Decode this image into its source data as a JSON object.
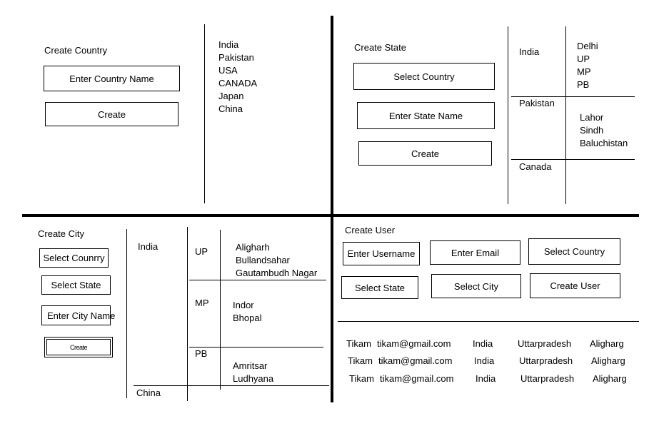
{
  "country_panel": {
    "title": "Create Country",
    "input_placeholder": "Enter Country Name",
    "create_button": "Create",
    "countries": [
      "India",
      "Pakistan",
      "USA",
      "CANADA",
      "Japan",
      "China"
    ]
  },
  "state_panel": {
    "title": "Create State",
    "select_country": "Select Country",
    "input_placeholder": "Enter State Name",
    "create_button": "Create",
    "table": [
      {
        "country": "India",
        "states": [
          "Delhi",
          "UP",
          "MP",
          "PB"
        ]
      },
      {
        "country": "Pakistan",
        "states": [
          "Lahor",
          "Sindh",
          "Baluchistan"
        ]
      },
      {
        "country": "Canada",
        "states": []
      }
    ]
  },
  "city_panel": {
    "title": "Create City",
    "select_country": "Select Counrry",
    "select_state": "Select State",
    "input_placeholder": "Enter City Name",
    "create_button": "Create",
    "country_india": "India",
    "country_china": "China",
    "states": [
      {
        "state": "UP",
        "cities": [
          "Aligharh",
          "Bullandsahar",
          "Gautambudh Nagar"
        ]
      },
      {
        "state": "MP",
        "cities": [
          "Indor",
          "Bhopal"
        ]
      },
      {
        "state": "PB",
        "cities": [
          "Amritsar",
          "Ludhyana"
        ]
      }
    ]
  },
  "user_panel": {
    "title": "Create User",
    "username_placeholder": "Enter Username",
    "email_placeholder": "Enter Email",
    "select_country": "Select Country",
    "select_state": "Select State",
    "select_city": "Select City",
    "create_button": "Create User",
    "users": [
      {
        "name": "Tikam",
        "email": "tikam@gmail.com",
        "country": "India",
        "state": "Uttarpradesh",
        "city": "Aligharg"
      },
      {
        "name": "Tikam",
        "email": "tikam@gmail.com",
        "country": "India",
        "state": "Uttarpradesh",
        "city": "Aligharg"
      },
      {
        "name": "Tikam",
        "email": "tikam@gmail.com",
        "country": "India",
        "state": "Uttarpradesh",
        "city": "Aligharg"
      }
    ]
  }
}
